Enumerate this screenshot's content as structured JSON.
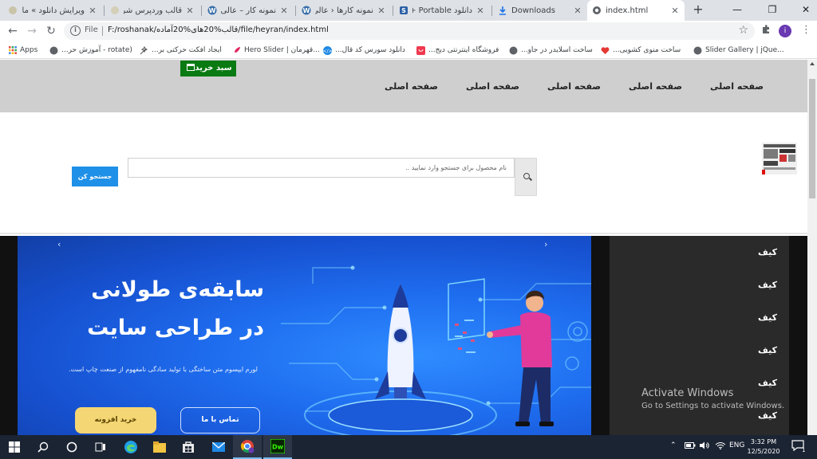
{
  "browser": {
    "tabs": [
      {
        "title": "ویرایش دانلود » مارا",
        "active": false
      },
      {
        "title": "قالب وردپرس شرک",
        "active": false
      },
      {
        "title": "نمونه کار – عالی",
        "active": false
      },
      {
        "title": "نمونه کارها ‹ عالی –",
        "active": false
      },
      {
        "title": "دانلود Portable + ج",
        "active": false
      },
      {
        "title": "Downloads",
        "active": false
      },
      {
        "title": "index.html",
        "active": true
      }
    ],
    "address": {
      "scheme_label": "File",
      "url": "F:/roshanak/قالب%20های%20آماده/file/heyran/index.html"
    },
    "profile_initial": "i",
    "bookmarks": [
      {
        "label": "Apps",
        "icon": "apps-grid-icon"
      },
      {
        "label": "(rotate - آموزش حر...",
        "icon": "globe-icon"
      },
      {
        "label": "ایجاد افکت حرکتی بر...",
        "icon": "sparkle-icon"
      },
      {
        "label": "Hero Slider | قهرمان...",
        "icon": "rocket-icon"
      },
      {
        "label": "دانلود سورس کد قال...",
        "icon": "code-icon"
      },
      {
        "label": "فروشگاه اینترنتی دیج...",
        "icon": "shop-icon"
      },
      {
        "label": "ساخت اسلایدر در جاو...",
        "icon": "globe-icon"
      },
      {
        "label": "ساخت منوی کشویی...",
        "icon": "heart-icon"
      },
      {
        "label": "Slider Gallery | jQue...",
        "icon": "globe-icon"
      }
    ]
  },
  "page": {
    "nav_items": [
      "صفحه اصلی",
      "صفحه اصلی",
      "صفحه اصلی",
      "صفحه اصلی",
      "صفحه اصلی"
    ],
    "cart_label": "سبد خرید",
    "search": {
      "placeholder": "نام محصول برای جستجو وارد نمایید ..",
      "button_label": "جستجو کن"
    },
    "hero": {
      "headline_line1": "سابقه‌ی طولانی",
      "headline_line2": "در طراحی سایت",
      "description": "لورم ایپسوم متن ساختگی با تولید سادگی نامفهوم از صنعت چاپ است.",
      "contact_button": "تماس با ما",
      "buy_button": "خرید افزونه"
    },
    "side_items": [
      "کیف",
      "کیف",
      "کیف",
      "کیف",
      "کیف",
      "کیف"
    ],
    "watermark": {
      "line1": "Activate Windows",
      "line2": "Go to Settings to activate Windows."
    }
  },
  "taskbar": {
    "language": "ENG",
    "time": "3:32 PM",
    "date": "12/5/2020",
    "notification_count": "11"
  },
  "colors": {
    "cart_green": "#0a7a12",
    "search_blue": "#1e90e8",
    "nav_gray": "#cfcfcf",
    "hero_blue": "#1f6ef0",
    "side_dark": "#2a2a2a",
    "buy_yellow": "#f4d674"
  }
}
